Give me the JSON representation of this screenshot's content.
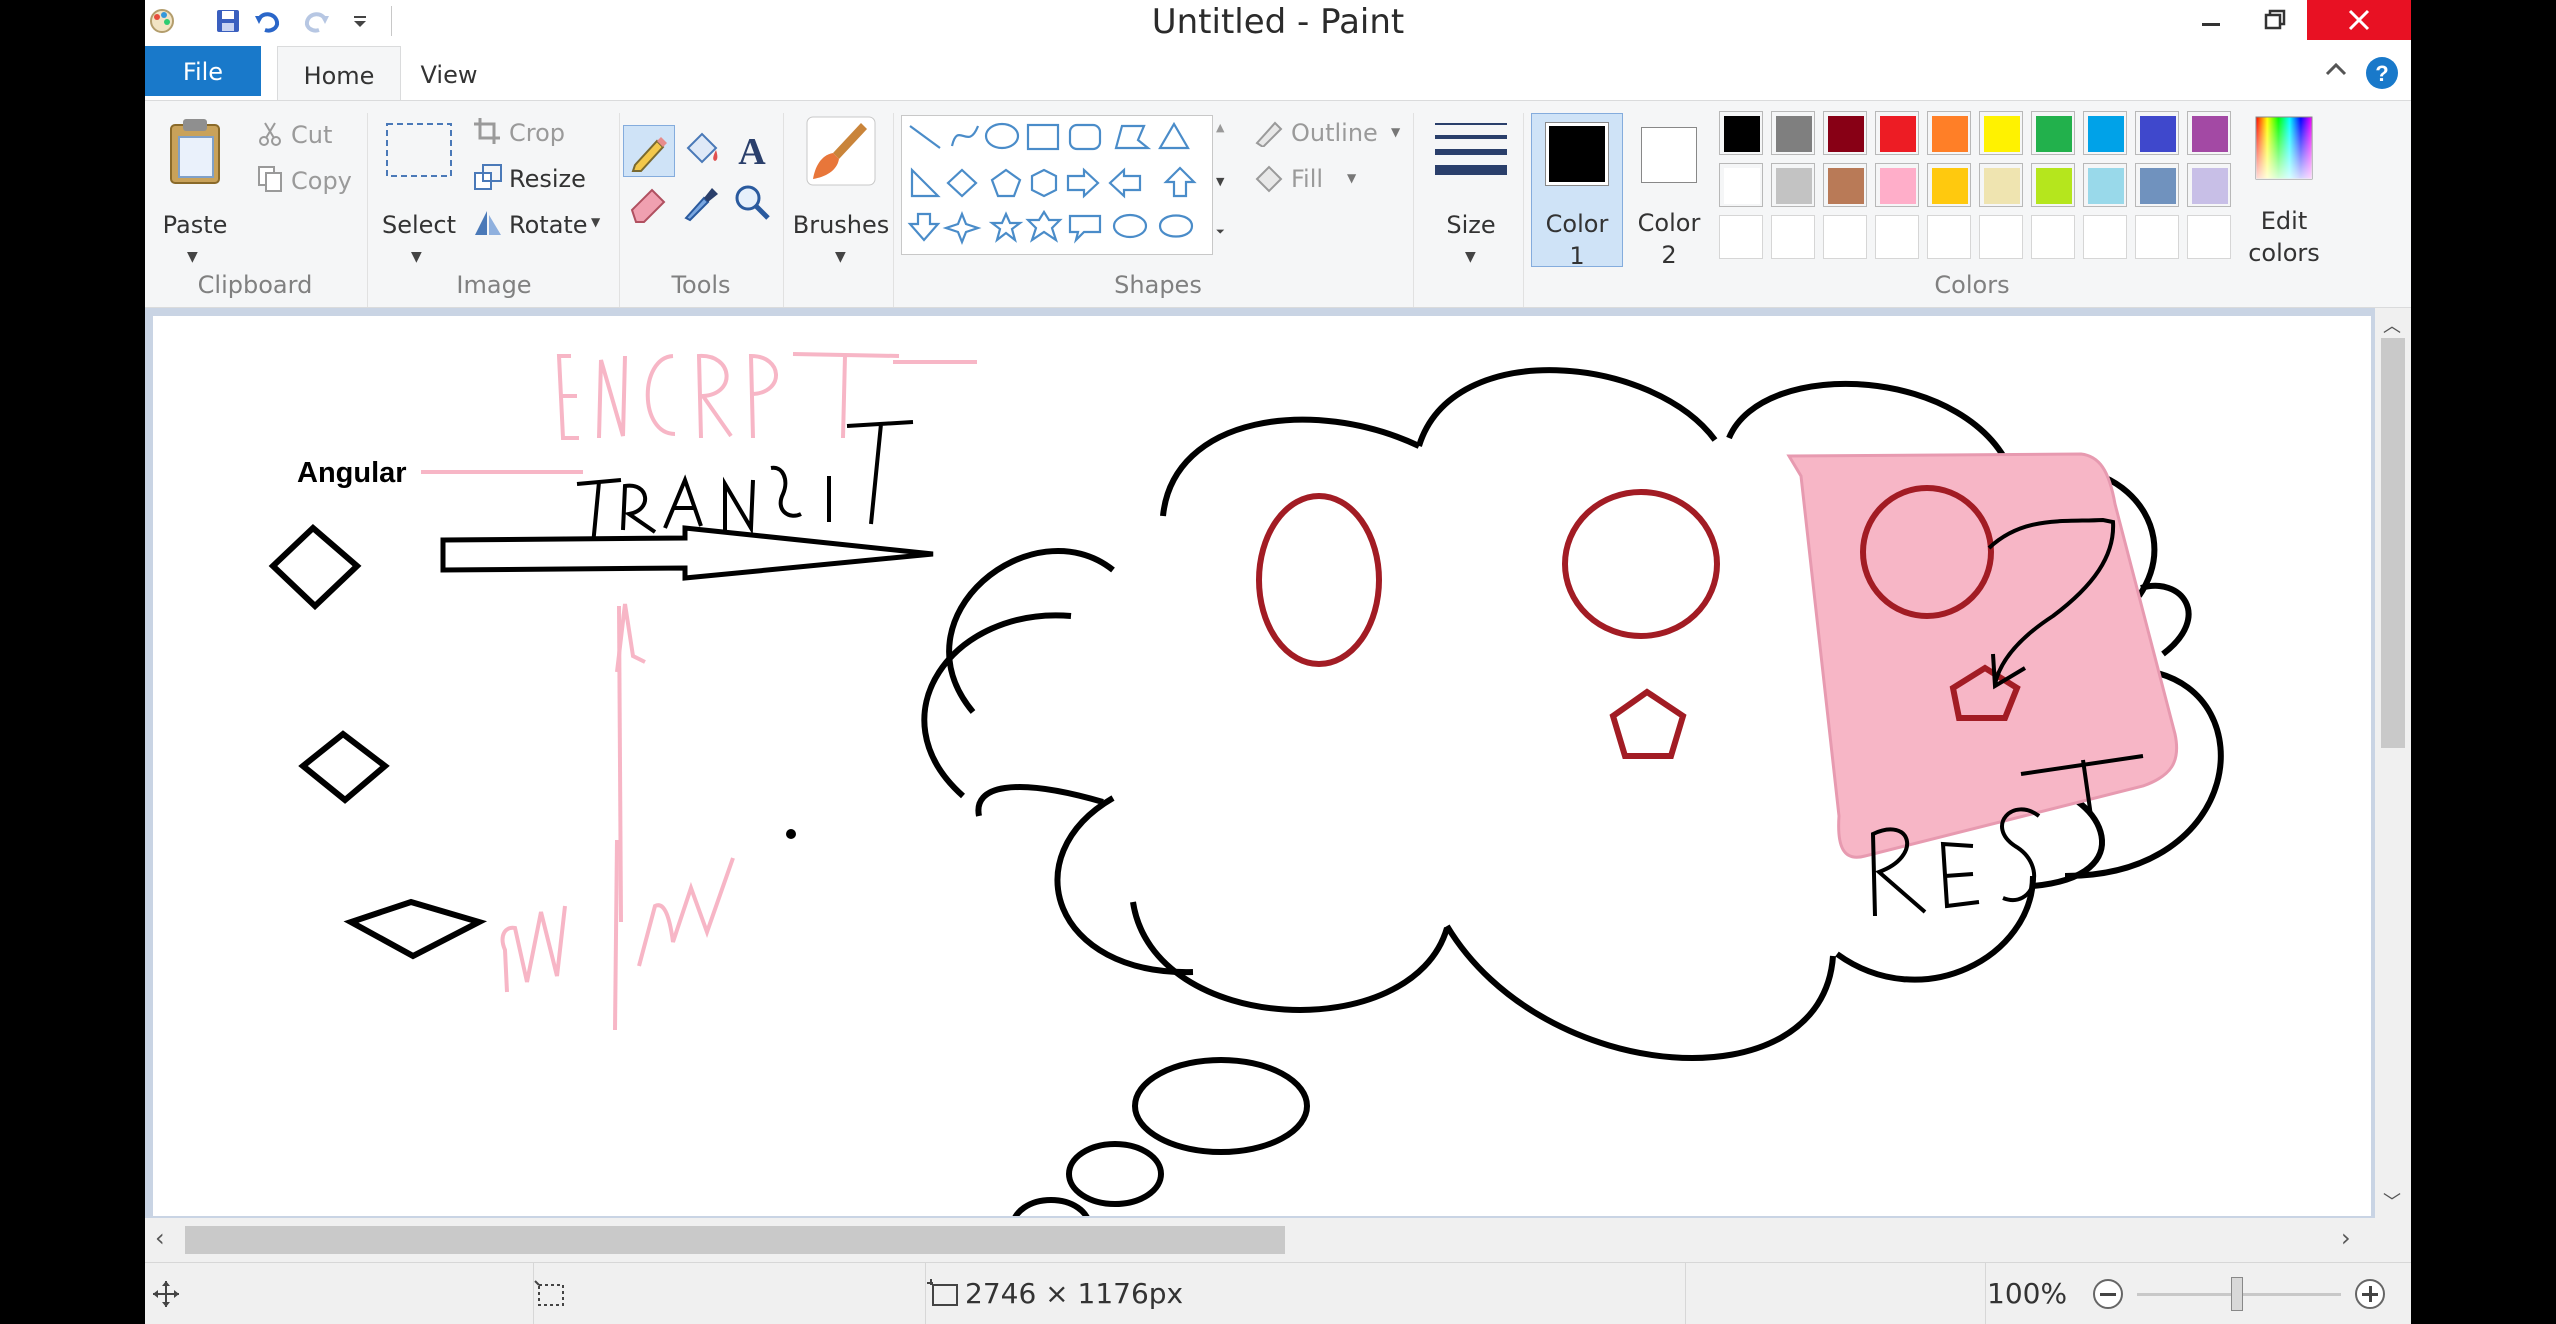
{
  "window": {
    "title": "Untitled - Paint",
    "quick_access": [
      "paint-app-icon",
      "save-icon",
      "undo-icon",
      "redo-icon",
      "customize-quick-access-icon"
    ]
  },
  "tabs": {
    "file": "File",
    "home": "Home",
    "view": "View"
  },
  "ribbon": {
    "clipboard": {
      "label": "Clipboard",
      "paste": "Paste",
      "cut": "Cut",
      "copy": "Copy"
    },
    "image": {
      "label": "Image",
      "select": "Select",
      "crop": "Crop",
      "resize": "Resize",
      "rotate": "Rotate"
    },
    "tools": {
      "label": "Tools"
    },
    "brushes": {
      "label": "Brushes"
    },
    "shapes": {
      "label": "Shapes",
      "outline": "Outline",
      "fill": "Fill"
    },
    "size": {
      "label": "Size"
    },
    "colors": {
      "label": "Colors",
      "color1": "Color",
      "color1_num": "1",
      "color2": "Color",
      "color2_num": "2",
      "edit_colors_1": "Edit",
      "edit_colors_2": "colors",
      "color1_value": "#000000",
      "color2_value": "#ffffff",
      "palette_row1": [
        "#000000",
        "#7f7f7f",
        "#880015",
        "#ed1c24",
        "#ff7f27",
        "#fff200",
        "#22b14c",
        "#00a2e8",
        "#3f48cc",
        "#a349a4"
      ],
      "palette_row2": [
        "#ffffff",
        "#c3c3c3",
        "#b97a57",
        "#ffaec9",
        "#ffc90e",
        "#efe4b0",
        "#b5e61d",
        "#99d9ea",
        "#7092be",
        "#c8bfe7"
      ]
    }
  },
  "canvas": {
    "angular_label": "Angular",
    "handwriting": [
      "ENCRPT",
      "TRANSIT",
      "REST",
      "W|W"
    ]
  },
  "status": {
    "image_size": "2746 × 1176px",
    "zoom": "100%"
  }
}
